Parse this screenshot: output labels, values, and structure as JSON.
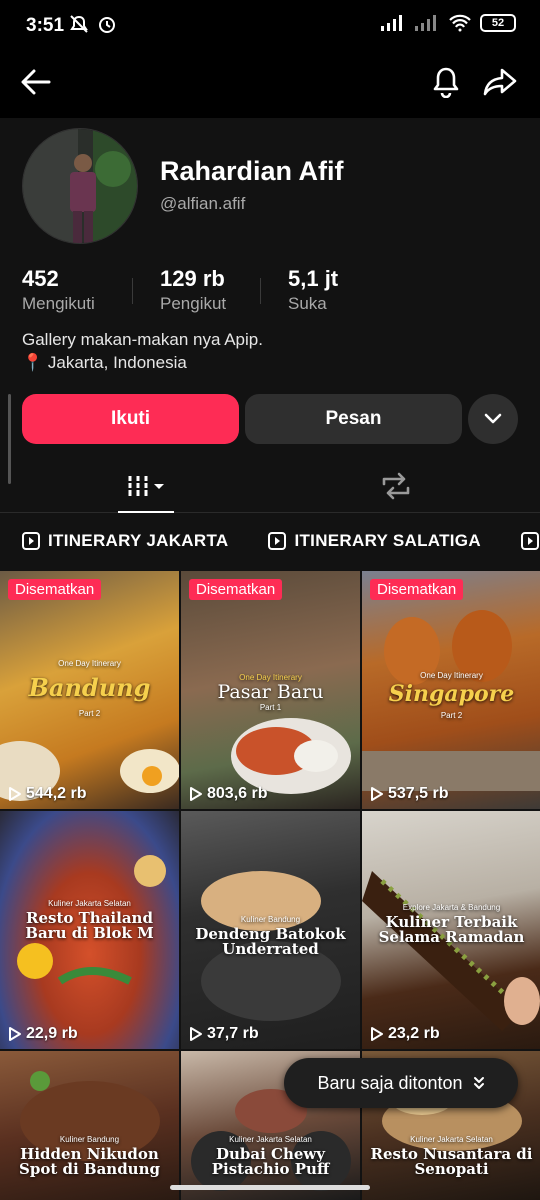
{
  "status": {
    "time": "3:51",
    "battery": "52"
  },
  "profile": {
    "name": "Rahardian Afif",
    "handle": "@alfian.afif",
    "stats": [
      {
        "value": "452",
        "label": "Mengikuti"
      },
      {
        "value": "129 rb",
        "label": "Pengikut"
      },
      {
        "value": "5,1 jt",
        "label": "Suka"
      }
    ],
    "bio_line1": "Gallery makan-makan nya Apip.",
    "bio_location": "📍 Jakarta, Indonesia"
  },
  "actions": {
    "follow": "Ikuti",
    "message": "Pesan"
  },
  "playlists": [
    "ITINERARY JAKARTA",
    "ITINERARY SALATIGA",
    "I"
  ],
  "videos": [
    {
      "pinned": "Disematkan",
      "views": "544,2 rb",
      "small": "One Day Itinerary",
      "title": "Bandung",
      "sub": "Part 2"
    },
    {
      "pinned": "Disematkan",
      "views": "803,6 rb",
      "small": "One Day Itinerary",
      "title": "Pasar Baru",
      "sub": "Part 1"
    },
    {
      "pinned": "Disematkan",
      "views": "537,5 rb",
      "small": "One Day Itinerary",
      "title": "Singapore",
      "sub": "Part 2"
    },
    {
      "views": "22,9 rb",
      "small": "Kuliner Jakarta Selatan",
      "title": "Resto Thailand Baru di Blok M"
    },
    {
      "views": "37,7 rb",
      "small": "Kuliner Bandung",
      "title": "Dendeng Batokok Underrated"
    },
    {
      "views": "23,2 rb",
      "small": "Explore Jakarta & Bandung",
      "title": "Kuliner Terbaik Selama Ramadan"
    },
    {
      "small": "Kuliner Bandung",
      "title": "Hidden Nikudon Spot di Bandung"
    },
    {
      "small": "Kuliner Jakarta Selatan",
      "title": "Dubai Chewy Pistachio Puff"
    },
    {
      "small": "Kuliner Jakarta Selatan",
      "title": "Resto Nusantara di Senopati"
    }
  ],
  "toast": {
    "label": "Baru saja ditonton"
  },
  "colors": {
    "accent": "#fe2c55",
    "background": "#121212"
  }
}
